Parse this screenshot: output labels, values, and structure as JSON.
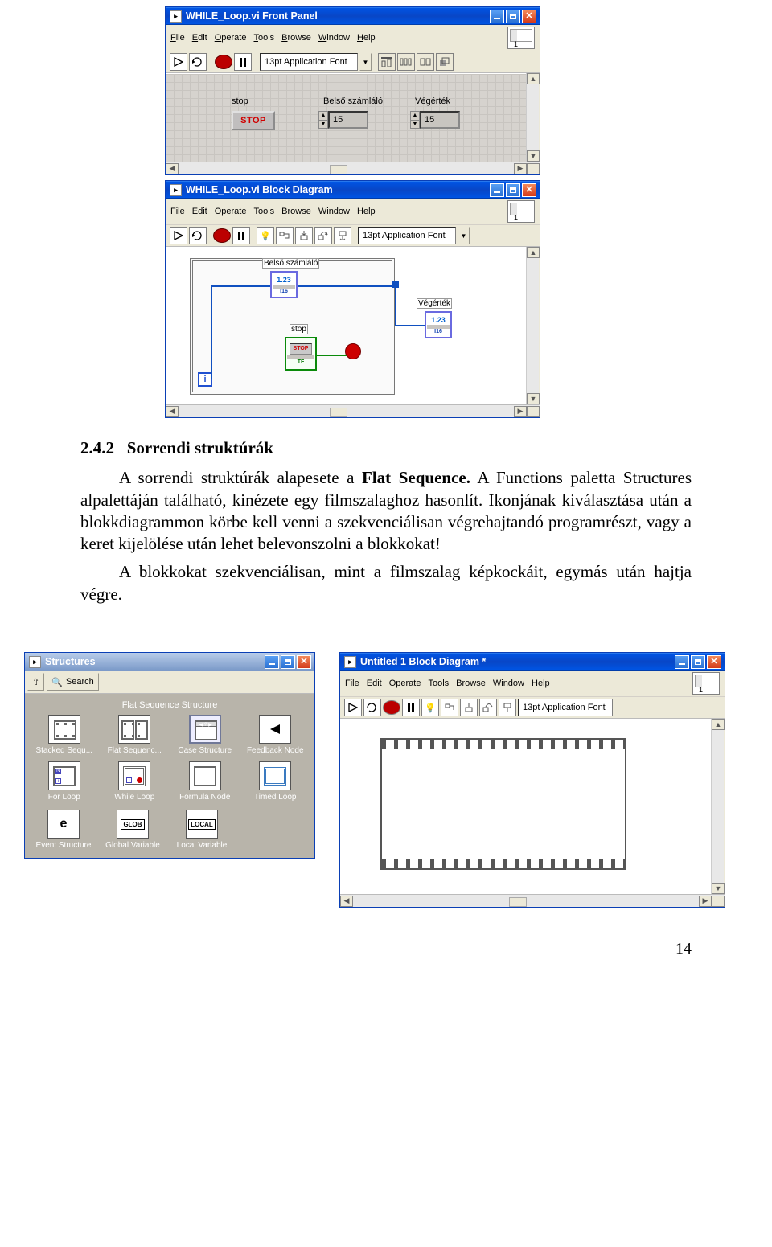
{
  "front_panel": {
    "title": "WHILE_Loop.vi Front Panel",
    "menu": [
      "File",
      "Edit",
      "Operate",
      "Tools",
      "Browse",
      "Window",
      "Help"
    ],
    "font": "13pt Application Font",
    "labels": {
      "stop": "stop",
      "counter": "Belső számláló",
      "end": "Végérték"
    },
    "stop_text": "STOP",
    "counter_val": "15",
    "end_val": "15"
  },
  "block_diagram": {
    "title": "WHILE_Loop.vi Block Diagram",
    "menu": [
      "File",
      "Edit",
      "Operate",
      "Tools",
      "Browse",
      "Window",
      "Help"
    ],
    "font": "13pt Application Font",
    "counter_label": "Belsõ számláló",
    "num_txt": "1.23",
    "sub": "I16",
    "stop_lbl": "stop",
    "stop_txt": "STOP",
    "tf": "TF",
    "end_label": "Végérték",
    "i": "i"
  },
  "doc": {
    "heading_no": "2.4.2",
    "heading_txt": "Sorrendi struktúrák",
    "p1a": "A sorrendi struktúrák alapesete a ",
    "p1b": "Flat Sequence.",
    "p1c": " A Functions paletta Structures alpalettáján található, kinézete egy filmszalaghoz hasonlít. Ikonjának kiválasztása után a blokkdiagrammon körbe kell venni a szekvenciálisan végrehajtandó programrészt, vagy a keret kijelölése után lehet belevonszolni a blokkokat!",
    "p2": "A blokkokat szekvenciálisan, mint a filmszalag képkockáit, egymás után hajtja végre."
  },
  "palette": {
    "title_win": "Structures",
    "search": "Search",
    "title": "Flat Sequence Structure",
    "items": [
      "Stacked Sequ...",
      "Flat Sequenc...",
      "Case Structure",
      "Feedback Node",
      "For Loop",
      "While Loop",
      "Formula Node",
      "Timed Loop"
    ],
    "row_b": [
      "Event Structure",
      "Global Variable",
      "Local Variable"
    ],
    "glob": "GLOB",
    "local": "LOCAL",
    "e": "e"
  },
  "untitled": {
    "title": "Untitled 1 Block Diagram *",
    "menu": [
      "File",
      "Edit",
      "Operate",
      "Tools",
      "Browse",
      "Window",
      "Help"
    ],
    "font": "13pt Application Font"
  },
  "pageno": "14"
}
